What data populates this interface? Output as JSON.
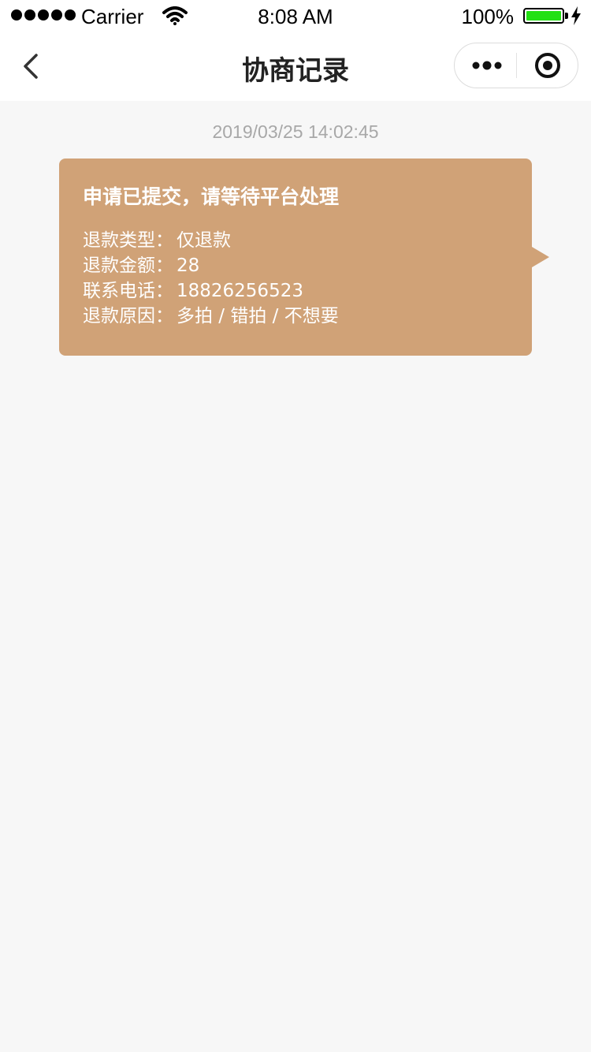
{
  "status_bar": {
    "carrier": "Carrier",
    "time": "8:08 AM",
    "battery_percent": "100%",
    "battery_color": "#23e014"
  },
  "nav": {
    "title": "协商记录",
    "back_icon": "chevron-left-icon",
    "more_icon": "more-dots-icon",
    "close_icon": "target-circle-icon"
  },
  "record": {
    "timestamp": "2019/03/25  14:02:45",
    "bubble_color": "#d0a277",
    "title": "申请已提交，请等待平台处理",
    "details": [
      {
        "label": "退款类型：",
        "value": "仅退款"
      },
      {
        "label": "退款金额：",
        "value": "28"
      },
      {
        "label": "联系电话：",
        "value": "18826256523"
      },
      {
        "label": "退款原因：",
        "value": "多拍 / 错拍 / 不想要"
      }
    ]
  }
}
